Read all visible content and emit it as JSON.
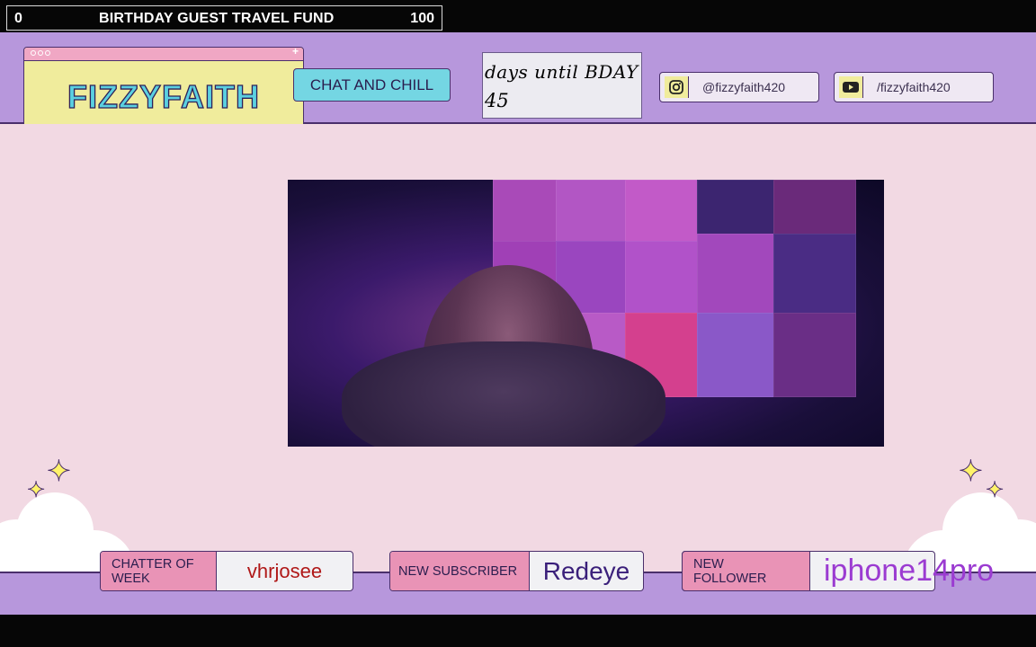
{
  "goal": {
    "min": "0",
    "title": "BIRTHDAY GUEST TRAVEL FUND",
    "max": "100"
  },
  "logo": {
    "text": "FIZZYFAITH"
  },
  "chat_badge": {
    "label": "CHAT AND CHILL"
  },
  "countdown": {
    "label": "days until BDAY",
    "value": "45"
  },
  "socials": [
    {
      "icon": "instagram-icon",
      "handle": "@fizzyfaith420"
    },
    {
      "icon": "youtube-icon",
      "handle": "/fizzyfaith420"
    }
  ],
  "alerts": {
    "chatter": {
      "label": "CHATTER OF WEEK",
      "value": "vhrjosee",
      "color": "#b01818"
    },
    "subscriber": {
      "label": "NEW SUBSCRIBER",
      "value": "Redeye",
      "color": "#3a1f7a"
    },
    "follower": {
      "label": "NEW FOLLOWER",
      "value": "iphone14pro",
      "color": "#9b3bd1"
    }
  },
  "colors": {
    "header_purple": "#b797dc",
    "stage_pink": "#f2d9e3",
    "logo_yellow": "#f0ec9c",
    "accent_cyan": "#74d6e3",
    "label_pink": "#e993b6"
  }
}
